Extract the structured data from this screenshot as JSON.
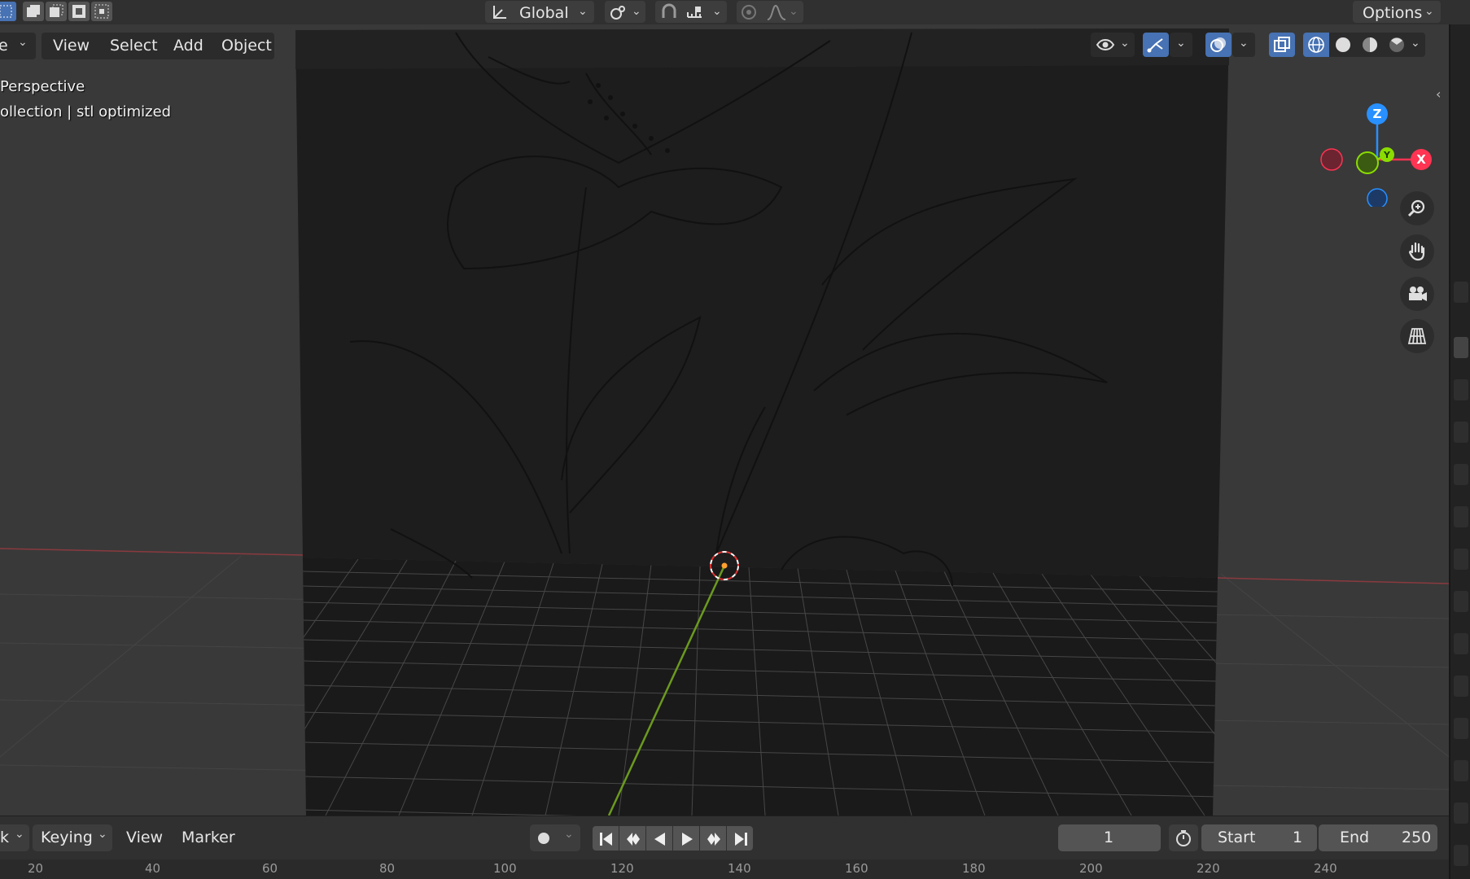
{
  "header": {
    "transform_orientation": "Global",
    "options_label": "Options"
  },
  "viewport": {
    "editor_mode_partial": "e",
    "menu": [
      "View",
      "Select",
      "Add",
      "Object"
    ],
    "overlay_line1": "Perspective",
    "overlay_line2": "ollection | stl optimized",
    "gizmo_axes": {
      "x": "X",
      "y": "Y",
      "z": "Z"
    },
    "axis_colors": {
      "x": "#ff3352",
      "y": "#8bdc00",
      "z": "#2890ff"
    }
  },
  "timeline": {
    "editor_partial": "k",
    "keying_label": "Keying",
    "view_label": "View",
    "marker_label": "Marker",
    "current_frame": "1",
    "start_label": "Start",
    "start_value": "1",
    "end_label": "End",
    "end_value": "250",
    "ruler_ticks": [
      "20",
      "40",
      "60",
      "80",
      "100",
      "120",
      "140",
      "160",
      "180",
      "200",
      "220",
      "240"
    ]
  },
  "colors": {
    "accent": "#4772b3",
    "background": "#303030",
    "viewport": "#393939"
  }
}
